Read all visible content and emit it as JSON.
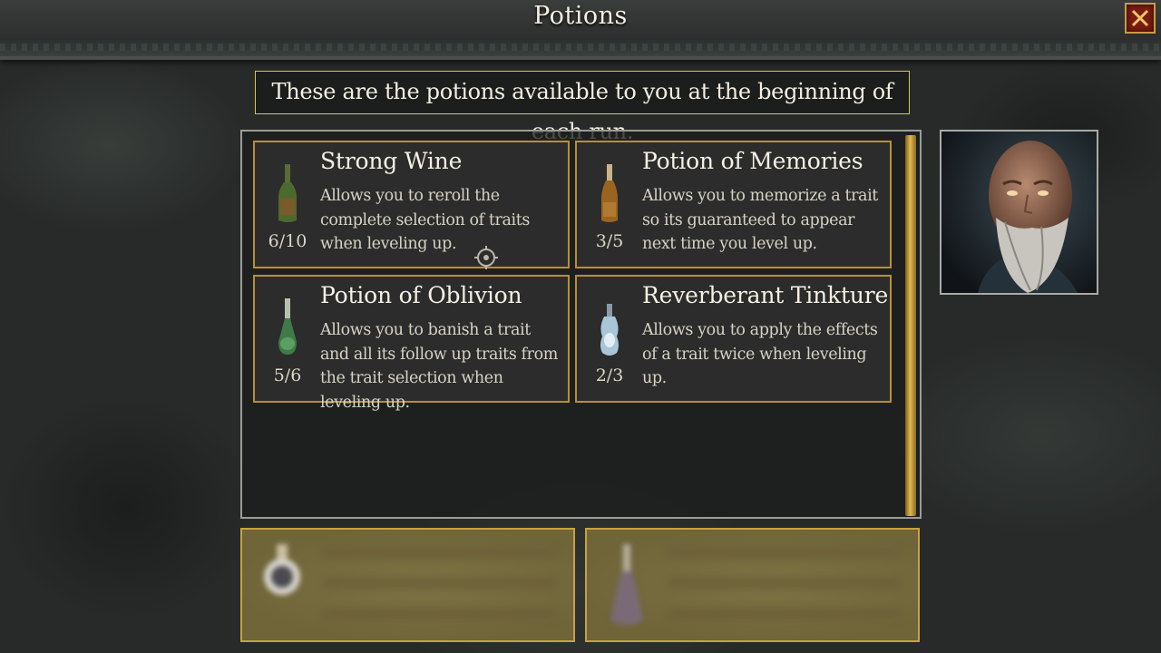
{
  "window": {
    "title": "Potions"
  },
  "info_banner": "These are the potions available to you at the beginning of each run.",
  "potions": [
    {
      "name": "Strong Wine",
      "description": "Allows you to reroll the complete selection of traits when leveling up.",
      "count": "6/10",
      "icon": "green-wine-bottle-icon"
    },
    {
      "name": "Potion of Memories",
      "description": "Allows you to memorize a trait so its guaranteed to appear next time you level up.",
      "count": "3/5",
      "icon": "amber-potion-bottle-icon"
    },
    {
      "name": "Potion of Oblivion",
      "description": "Allows you to  banish a trait and all its follow up traits from the trait selection when leveling up.",
      "count": "5/6",
      "icon": "green-flask-icon"
    },
    {
      "name": "Reverberant Tinkture",
      "description": "Allows you to apply the effects of a trait twice when leveling up.",
      "count": "2/3",
      "icon": "pale-blue-flask-icon"
    }
  ],
  "colors": {
    "card_border": "#b8912e",
    "banner_border": "#d4c84c",
    "close_button": "#7a1c12",
    "scrollbar": "#e0b94e"
  }
}
